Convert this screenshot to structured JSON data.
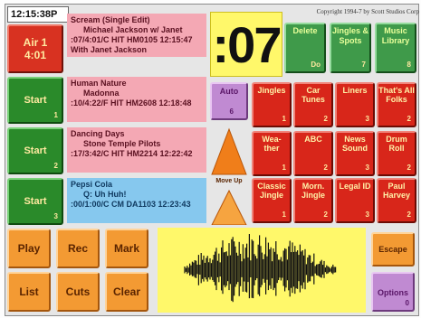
{
  "header": {
    "clock": "12:15:38P",
    "copyright": "Copyright 1994-7 by Scott Studios Corp",
    "countdown": ":07",
    "air_label": "Air 1",
    "air_time": "4:01"
  },
  "decks": [
    {
      "button": "Start",
      "number": "1",
      "title": "Scream (Single Edit)",
      "artist": "Michael Jackson w/ Janet",
      "info": ":07/4:01/C HIT HM0105 12:15:47",
      "extra": "With Janet Jackson"
    },
    {
      "button": "Start",
      "number": "2",
      "title": "Human Nature",
      "artist": "Madonna",
      "info": ":10/4:22/F HIT HM2608 12:18:48",
      "extra": ""
    },
    {
      "button": "Start",
      "number": "3",
      "title": "Dancing Days",
      "artist": "Stone Temple Pilots",
      "info": ":17/3:42/C HIT HM2214 12:22:42",
      "extra": ""
    },
    {
      "button": "Start",
      "number": "4",
      "title": "Pepsi Cola",
      "artist": "Q: Uh Huh!",
      "info": ":00/1:00/C CM DA1103 12:23:43",
      "extra": ""
    }
  ],
  "top_buttons": [
    {
      "label": "Delete",
      "sub": "Do"
    },
    {
      "label": "Jingles & Spots",
      "sub": "7"
    },
    {
      "label": "Music Library",
      "sub": "8"
    }
  ],
  "auto": {
    "label": "Auto",
    "sub": "6"
  },
  "move_up": {
    "label": "Move Up"
  },
  "jingles": [
    {
      "label": "Jingles",
      "sub": "1"
    },
    {
      "label": "Car Tunes",
      "sub": "2"
    },
    {
      "label": "Liners",
      "sub": "3"
    },
    {
      "label": "That's All Folks",
      "sub": "2"
    },
    {
      "label": "Wea- ther",
      "sub": "1"
    },
    {
      "label": "ABC",
      "sub": "2"
    },
    {
      "label": "News Sound",
      "sub": "3"
    },
    {
      "label": "Drum Roll",
      "sub": "2"
    },
    {
      "label": "Classic Jingle",
      "sub": "1"
    },
    {
      "label": "Morn. Jingle",
      "sub": "2"
    },
    {
      "label": "Legal ID",
      "sub": "3"
    },
    {
      "label": "Paul Harvey",
      "sub": "2"
    }
  ],
  "transport": {
    "play": "Play",
    "rec": "Rec",
    "mark": "Mark",
    "list": "List",
    "cuts": "Cuts",
    "clear": "Clear"
  },
  "side": {
    "escape": "Escape",
    "options": "Options",
    "options_sub": "0"
  },
  "colors": {
    "red": "#d83221",
    "green": "#2a8a2a",
    "orange": "#f39a33",
    "yellow": "#fff86a",
    "pink": "#f4a8b4",
    "cyan": "#86c8ee"
  }
}
